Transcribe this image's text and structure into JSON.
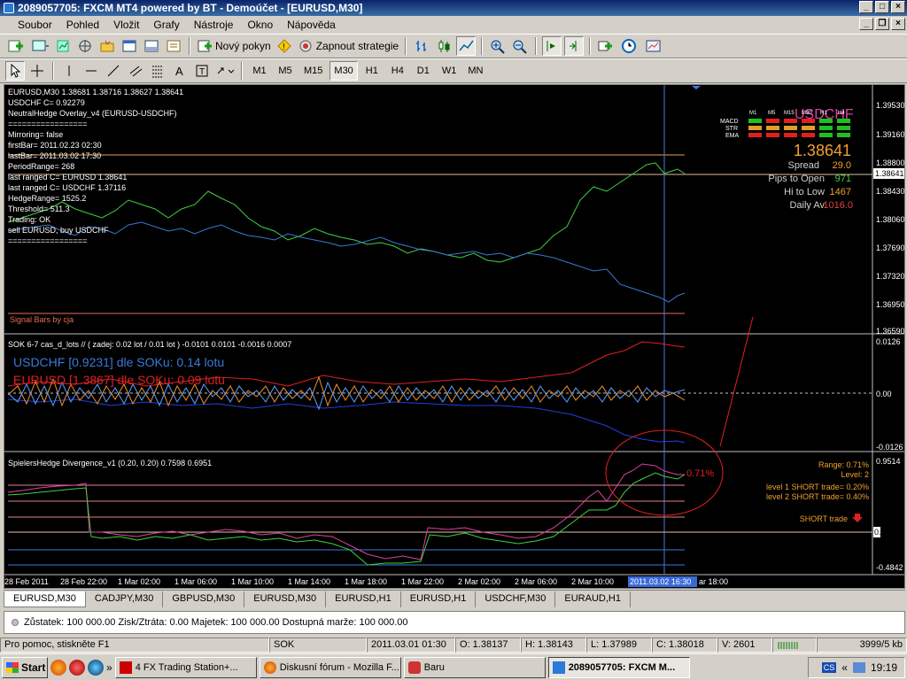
{
  "window": {
    "title": "2089057705: FXCM MT4 powered by BT - Demoúčet - [EURUSD,M30]"
  },
  "menu": [
    "Soubor",
    "Pohled",
    "Vložit",
    "Grafy",
    "Nástroje",
    "Okno",
    "Nápověda"
  ],
  "toolbar1": {
    "new_order": "Nový pokyn",
    "strategies": "Zapnout strategie"
  },
  "timeframes": [
    "M1",
    "M5",
    "M15",
    "M30",
    "H1",
    "H4",
    "D1",
    "W1",
    "MN"
  ],
  "active_timeframe": "M30",
  "main_panel": {
    "info_lines": [
      "EURUSD,M30 1.38681 1.38716 1.38627 1.38641",
      "USDCHF C= 0.92279",
      "NeutralHedge Overlay_v4 (EURUSD-USDCHF)",
      "=================",
      "Mirroring= false",
      "firstBar= 2011.02.23 02:30",
      "lastBar= 2011.03.02 17:30",
      "PeriodRange= 268",
      "last ranged C= EURUSD 1.38641",
      "last ranged C= USDCHF 1.37116",
      "HedgeRange= 1525.2",
      "Threshold= 511.3",
      "Trading: OK",
      "sell EURUSD, buy USDCHF",
      "================="
    ],
    "signal_label": "Signal Bars by cja",
    "symbol_overlay": "USDCHF",
    "matrix_cols": [
      "M1",
      "M5",
      "M15",
      "M30",
      "H1",
      "H4"
    ],
    "matrix_rows": [
      "MACD",
      "STR",
      "EMA"
    ],
    "price": "1.38641",
    "spread_label": "Spread",
    "spread_value": "29.0",
    "pips_label": "Pips to Open",
    "pips_value": "971",
    "hilo_label": "Hi to Low",
    "hilo_value": "1467",
    "daily_label": "Daily Av",
    "daily_value": "1016.0",
    "price_scale": [
      "1.39530",
      "1.39160",
      "1.38800",
      "1.38430",
      "1.38060",
      "1.37690",
      "1.37320",
      "1.36950",
      "1.36590"
    ],
    "current_price_tag": "1.38641"
  },
  "sok_panel": {
    "header": "SOK 6-7 cas_d_lots // ( zadej: 0.02 lot / 0.01 lot ) -0.0101 0.0101 -0.0016 0.0007",
    "line1": "USDCHF [0.9231]  dle SOKu: 0.14 lotu",
    "line2": "EURUSD [1.3867]  dle SOKu: 0.09 lotu",
    "scale": [
      "0.0126",
      "0.00",
      "-0.0126"
    ]
  },
  "div_panel": {
    "header": "SpielersHedge Divergence_v1 (0.20, 0.20)  0.7598 0.6951",
    "callout": "0.71%",
    "range": "Range: 0.71%",
    "level": "Level: 2",
    "level1": "level 1 SHORT trade= 0.20%",
    "level2": "level 2 SHORT trade= 0.40%",
    "short": "SHORT trade",
    "scale": [
      "0.9514",
      "0.00",
      "-0.4842"
    ]
  },
  "time_axis": [
    "28 Feb 2011",
    "28 Feb 22:00",
    "1 Mar 02:00",
    "1 Mar 06:00",
    "1 Mar 10:00",
    "1 Mar 14:00",
    "1 Mar 18:00",
    "1 Mar 22:00",
    "2 Mar 02:00",
    "2 Mar 06:00",
    "2 Mar 10:00",
    "2011.03.02 16:30",
    "ar 18:00"
  ],
  "tabs": [
    "EURUSD,M30",
    "CADJPY,M30",
    "GBPUSD,M30",
    "EURUSD,M30",
    "EURUSD,H1",
    "EURUSD,H1",
    "USDCHF,M30",
    "EURAUD,H1"
  ],
  "terminal": {
    "text": "Zůstatek: 100 000.00  Zisk/Ztráta: 0.00  Majetek: 100 000.00  Dostupná marže: 100 000.00"
  },
  "status": {
    "help": "Pro pomoc, stiskněte F1",
    "profile": "SOK",
    "datetime": "2011.03.01 01:30",
    "open": "O: 1.38137",
    "high": "H: 1.38143",
    "low": "L: 1.37989",
    "close": "C: 1.38018",
    "volume": "V: 2601",
    "traffic": "3999/5 kb"
  },
  "taskbar": {
    "start": "Start",
    "tasks": [
      "4 FX Trading Station+...",
      "Diskusní fórum - Mozilla F...",
      "Baru",
      "2089057705: FXCM M..."
    ],
    "clock": "19:19",
    "lang": "CS"
  }
}
